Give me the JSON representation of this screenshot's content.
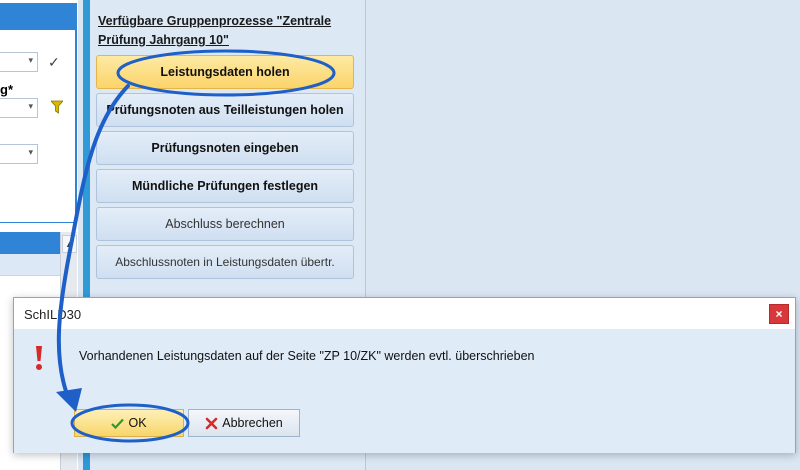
{
  "left_panel": {
    "field_label_fragment": "g*",
    "combo_arrow": "▾",
    "scroll_up_arrow": "▲"
  },
  "process_panel": {
    "title": "Verfügbare Gruppenprozesse \"Zentrale Prüfung Jahrgang 10\"",
    "buttons": [
      {
        "label": "Leistungsdaten holen",
        "highlighted": true
      },
      {
        "label": "Prüfungsnoten aus Teilleistungen holen"
      },
      {
        "label": "Prüfungsnoten eingeben"
      },
      {
        "label": "Mündliche Prüfungen festlegen"
      },
      {
        "label": "Abschluss berechnen"
      },
      {
        "label": "Abschlussnoten in Leistungsdaten übertr."
      }
    ]
  },
  "dialog": {
    "title": "SchILD30",
    "close_label": "×",
    "message": "Vorhandenen Leistungsdaten auf der Seite \"ZP 10/ZK\" werden evtl. überschrieben",
    "ok_label": "OK",
    "cancel_label": "Abbrechen"
  },
  "icons": {
    "check": "check-icon",
    "filter": "filter-icon",
    "warning": "exclamation-icon",
    "ok": "checkmark-icon",
    "cancel": "x-icon"
  },
  "colors": {
    "accent_blue": "#2f84d6",
    "highlight_yellow": "#fbd46a",
    "annotation_blue": "#1f5fc8",
    "close_red": "#d9383a",
    "warning_red": "#d42a2a"
  }
}
